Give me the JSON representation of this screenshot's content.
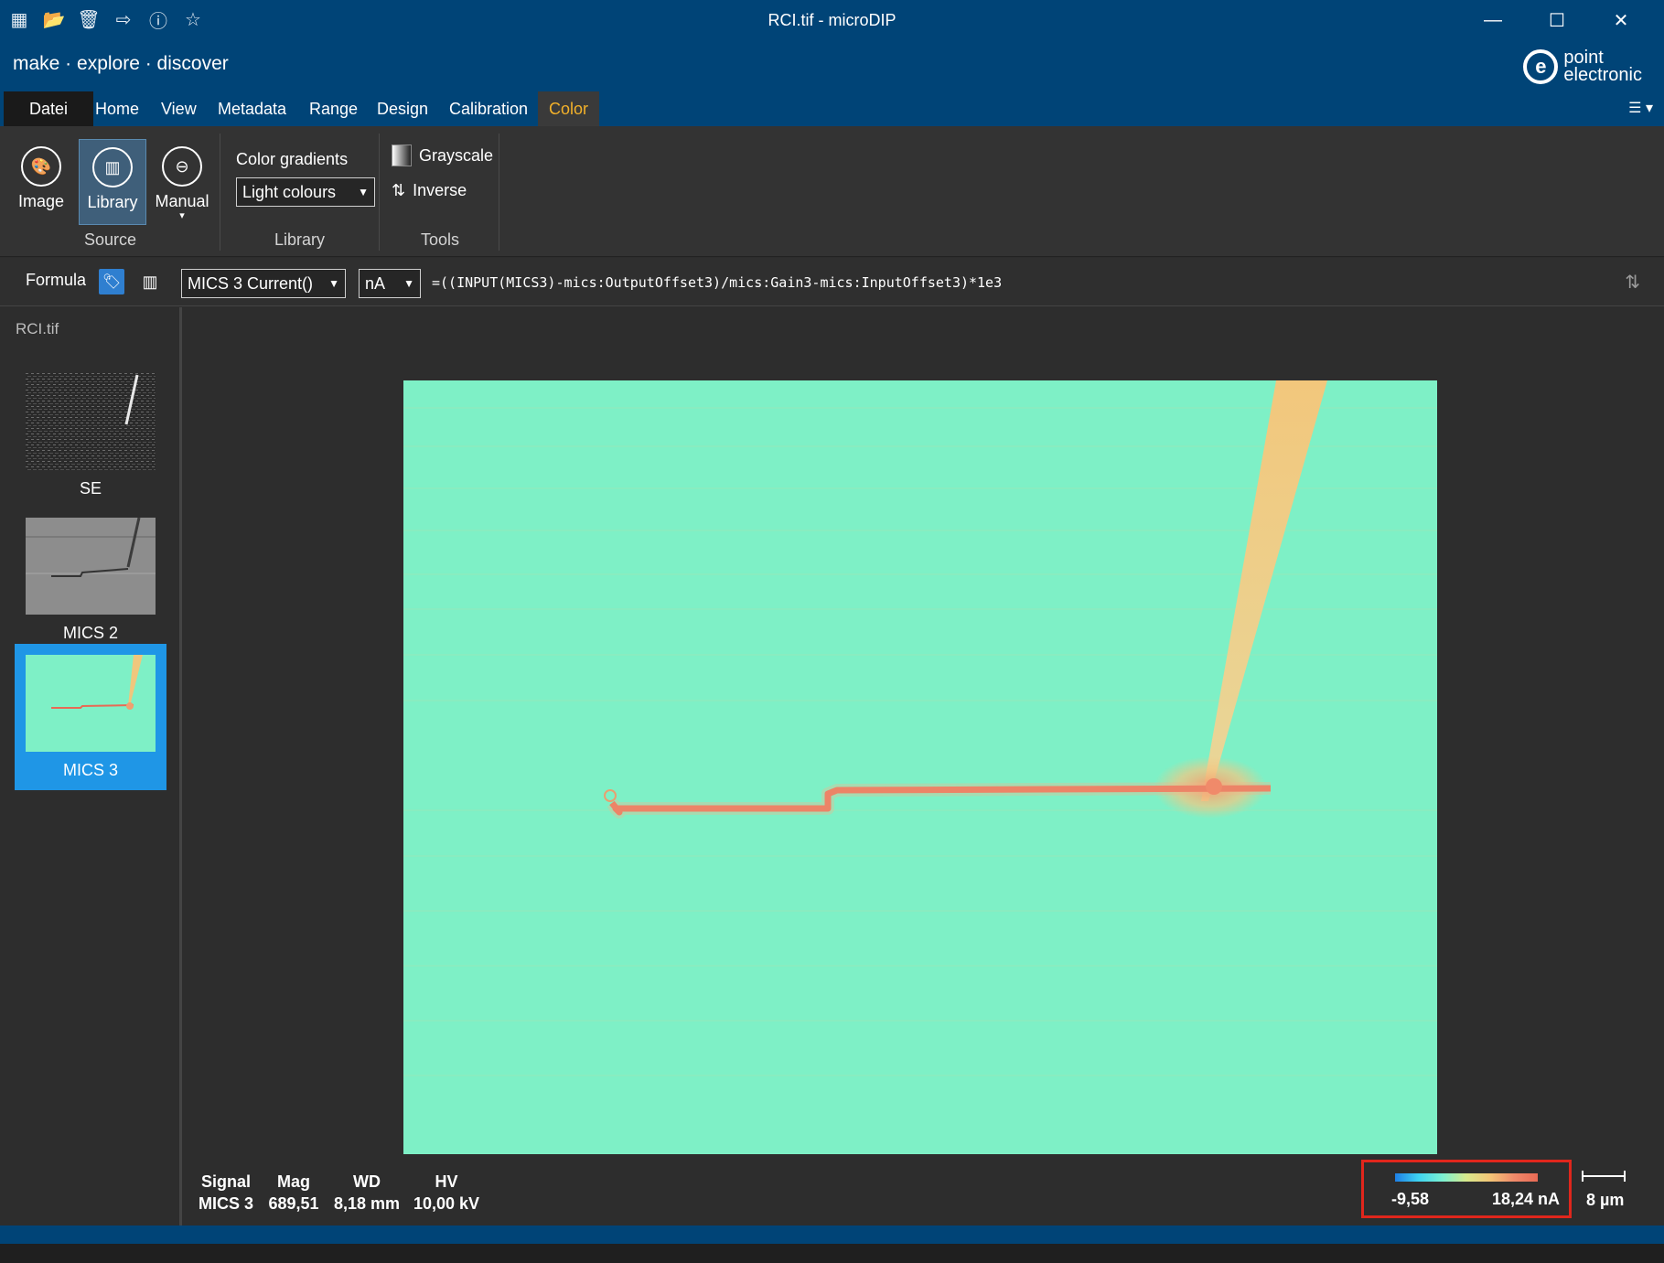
{
  "window": {
    "title": "RCI.tif - microDIP",
    "toolbar_icons": [
      "app-icon",
      "open-folder-icon",
      "delete-icon",
      "export-icon",
      "info-icon",
      "star-icon"
    ],
    "controls": {
      "minimize": "—",
      "maximize": "☐",
      "close": "✕"
    }
  },
  "brand": {
    "tagline": "make · explore · discover",
    "logo_line1": "point",
    "logo_line2": "electronic"
  },
  "menu": {
    "items": [
      "Datei",
      "Home",
      "View",
      "Metadata",
      "Range",
      "Design",
      "Calibration",
      "Color"
    ],
    "active": "Color",
    "active_color": "#f3b12a"
  },
  "ribbon": {
    "source": {
      "label": "Source",
      "buttons": [
        "Image",
        "Library",
        "Manual"
      ],
      "active": "Library"
    },
    "library": {
      "label": "Library",
      "gradients_label": "Color gradients",
      "gradient_value": "Light colours"
    },
    "tools": {
      "label": "Tools",
      "grayscale": "Grayscale",
      "inverse": "Inverse"
    }
  },
  "formula": {
    "label": "Formula",
    "signal_select": "MICS 3 Current()",
    "unit_select": "nA",
    "expression": "=((INPUT(MICS3)-mics:OutputOffset3)/mics:Gain3-mics:InputOffset3)*1e3"
  },
  "sidebar": {
    "file": "RCI.tif",
    "thumbnails": [
      {
        "label": "SE",
        "selected": false
      },
      {
        "label": "MICS 2",
        "selected": false
      },
      {
        "label": "MICS 3",
        "selected": true
      }
    ]
  },
  "image_info": {
    "signal_label": "Signal",
    "signal_value": "MICS 3",
    "mag_label": "Mag",
    "mag_value": "689,51",
    "wd_label": "WD",
    "wd_value": "8,18 mm",
    "hv_label": "HV",
    "hv_value": "10,00 kV"
  },
  "color_legend": {
    "min": "-9,58",
    "max": "18,24 nA",
    "highlight_color": "#e0261c"
  },
  "scale_bar": {
    "label": "8 µm"
  },
  "colors": {
    "title_bar": "#004477",
    "image_background": "#7ef0c6",
    "signal_trace": "#e86a55",
    "probe_tip": "#efc77d",
    "selection": "#1f96e6"
  }
}
